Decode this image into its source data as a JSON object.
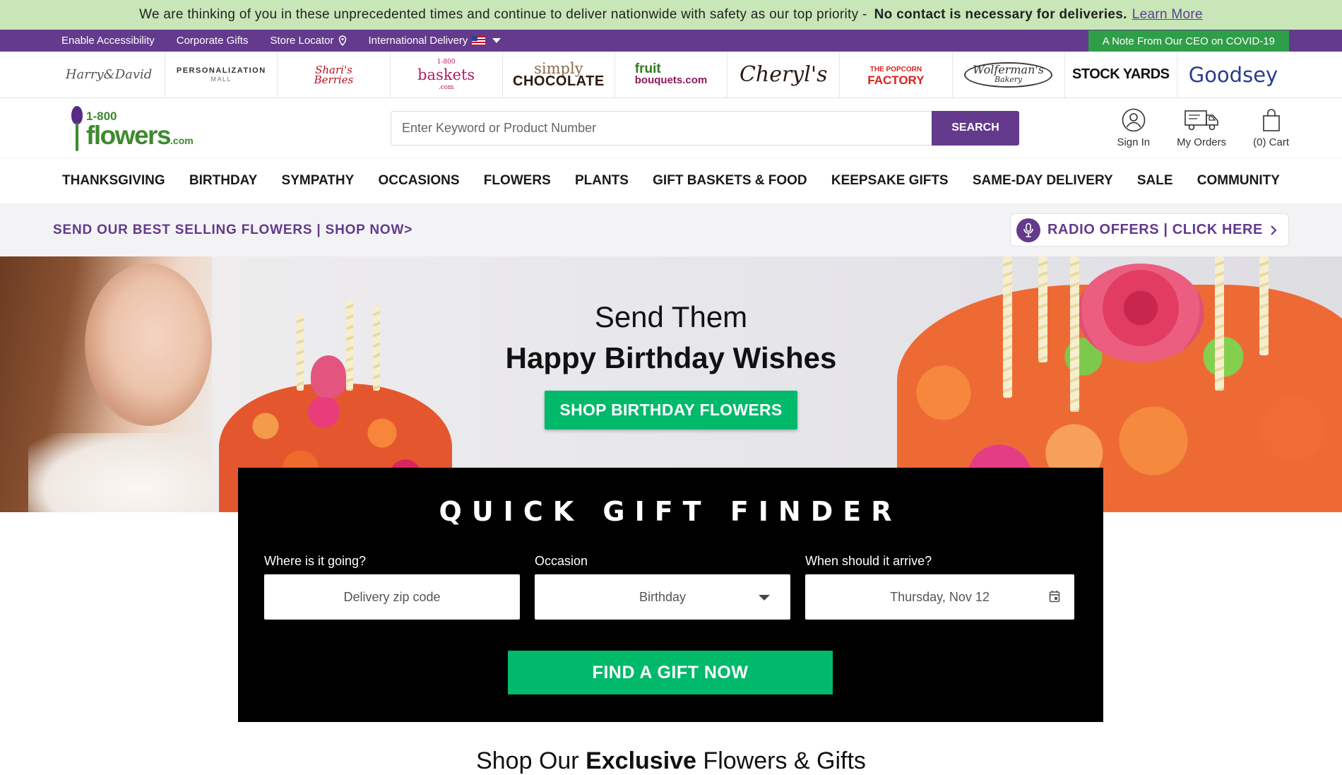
{
  "notice": {
    "text": "We are thinking of you in these unprecedented times and continue to deliver nationwide with safety as our top priority -",
    "bold": "No contact is necessary for deliveries.",
    "link": "Learn More"
  },
  "util": {
    "accessibility": "Enable Accessibility",
    "corporate": "Corporate Gifts",
    "store_locator": "Store Locator",
    "international": "International Delivery",
    "ceo_note": "A Note From Our CEO on COVID-19"
  },
  "brands": {
    "harry_david": "Harry&David",
    "pm_main": "PERSONALIZATION",
    "pm_sub": "MALL",
    "sharis_1": "Shari's",
    "sharis_2": "Berries",
    "baskets_pre": "1-800",
    "baskets": "baskets",
    "baskets_suf": ".com",
    "simply": "simply",
    "chocolate": "CHOCOLATE",
    "fruit": "fruit",
    "bouquets": "bouquets.com",
    "cheryls": "Cheryl's",
    "popcorn_1": "THE POPCORN",
    "popcorn_2": "FACTORY",
    "wolfermans_1": "Wolferman's",
    "wolfermans_2": "Bakery",
    "stockyards": "STOCK YARDS",
    "goodsey": "Goodsey"
  },
  "header": {
    "logo_num": "1-800",
    "logo_word": "flowers",
    "logo_com": ".com",
    "search_placeholder": "Enter Keyword or Product Number",
    "search_button": "SEARCH",
    "sign_in": "Sign In",
    "my_orders": "My Orders",
    "cart": "(0) Cart"
  },
  "nav": [
    "THANKSGIVING",
    "BIRTHDAY",
    "SYMPATHY",
    "OCCASIONS",
    "FLOWERS",
    "PLANTS",
    "GIFT BASKETS & FOOD",
    "KEEPSAKE GIFTS",
    "SAME-DAY DELIVERY",
    "SALE",
    "COMMUNITY"
  ],
  "promo": {
    "left": "SEND OUR BEST SELLING FLOWERS | SHOP NOW>",
    "radio": "RADIO OFFERS | CLICK HERE"
  },
  "hero": {
    "line1": "Send Them",
    "line2": "Happy Birthday Wishes",
    "button": "SHOP BIRTHDAY FLOWERS"
  },
  "finder": {
    "title": "QUICK GIFT FINDER",
    "where_label": "Where is it going?",
    "where_placeholder": "Delivery zip code",
    "occasion_label": "Occasion",
    "occasion_value": "Birthday",
    "when_label": "When should it arrive?",
    "when_value": "Thursday, Nov 12",
    "button": "FIND A GIFT NOW"
  },
  "bottom": {
    "pre": "Shop Our",
    "bold": "Exclusive",
    "post": "Flowers & Gifts"
  }
}
